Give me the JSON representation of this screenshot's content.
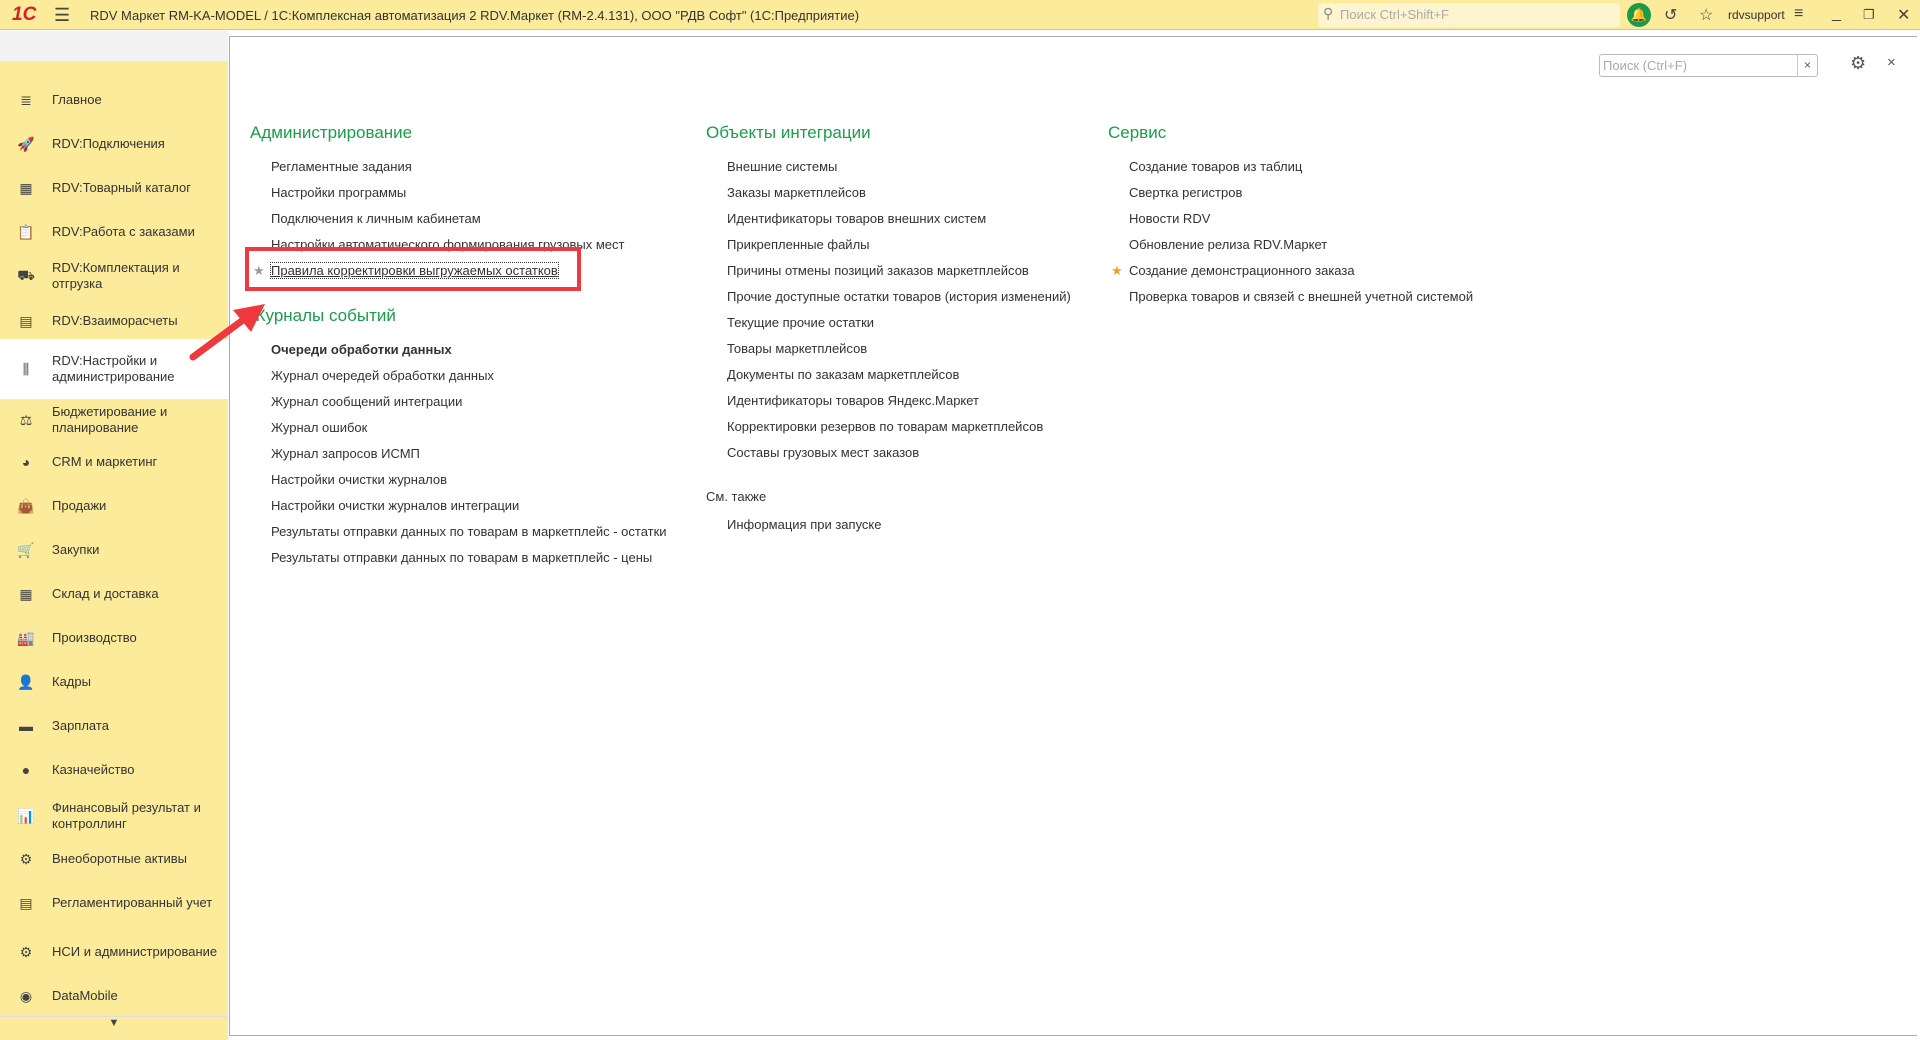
{
  "titlebar": {
    "logo": "1С",
    "title": "RDV Маркет RM-KA-MODEL / 1С:Комплексная автоматизация 2 RDV.Маркет (RM-2.4.131), ООО \"РДВ Софт\"  (1С:Предприятие)",
    "search_placeholder": "Поиск Ctrl+Shift+F",
    "user": "rdvsupport"
  },
  "sidebar": {
    "items": [
      {
        "label": "Главное",
        "icon": "≣"
      },
      {
        "label": "RDV:Подключения",
        "icon": "🚀"
      },
      {
        "label": "RDV:Товарный каталог",
        "icon": "▦"
      },
      {
        "label": "RDV:Работа с заказами",
        "icon": "📋"
      },
      {
        "label": "RDV:Комплектация и отгрузка",
        "icon": "⛟"
      },
      {
        "label": "RDV:Взаиморасчеты",
        "icon": "▤"
      },
      {
        "label": "RDV:Настройки и администрирование",
        "icon": "⫼",
        "active": true
      },
      {
        "label": "Бюджетирование и планирование",
        "icon": "⚖"
      },
      {
        "label": "CRM и маркетинг",
        "icon": "◕"
      },
      {
        "label": "Продажи",
        "icon": "👜"
      },
      {
        "label": "Закупки",
        "icon": "🛒"
      },
      {
        "label": "Склад и доставка",
        "icon": "▦"
      },
      {
        "label": "Производство",
        "icon": "🏭"
      },
      {
        "label": "Кадры",
        "icon": "👤"
      },
      {
        "label": "Зарплата",
        "icon": "▬"
      },
      {
        "label": "Казначейство",
        "icon": "●"
      },
      {
        "label": "Финансовый результат и контроллинг",
        "icon": "📊"
      },
      {
        "label": "Внеоборотные активы",
        "icon": "⚙"
      },
      {
        "label": "Регламентированный учет",
        "icon": "▤"
      },
      {
        "label": "НСИ и администрирование",
        "icon": "⚙"
      },
      {
        "label": "DataMobile",
        "icon": "◉"
      }
    ],
    "scroll_down": "▼"
  },
  "main": {
    "search_placeholder": "Поиск (Ctrl+F)",
    "clear": "×",
    "close": "×",
    "col1": {
      "heading": "Администрирование",
      "items": [
        "Регламентные задания",
        "Настройки программы",
        "Подключения к личным кабинетам",
        "Настройки автоматического формирования грузовых мест",
        "Правила корректировки выгружаемых остатков"
      ],
      "heading2": "Журналы событий",
      "items2": [
        "Очереди обработки данных",
        "Журнал очередей обработки данных",
        "Журнал сообщений интеграции",
        "Журнал ошибок",
        "Журнал запросов ИСМП",
        "Настройки очистки журналов",
        "Настройки очистки журналов интеграции",
        "Результаты отправки данных по товарам в маркетплейс - остатки",
        "Результаты отправки данных по товарам в маркетплейс - цены"
      ]
    },
    "col2": {
      "heading": "Объекты интеграции",
      "items": [
        "Внешние системы",
        "Заказы маркетплейсов",
        "Идентификаторы товаров внешних систем",
        "Прикрепленные файлы",
        "Причины отмены позиций заказов маркетплейсов",
        "Прочие доступные остатки товаров (история изменений)",
        "Текущие прочие остатки",
        "Товары маркетплейсов",
        "Документы по заказам маркетплейсов",
        "Идентификаторы товаров Яндекс.Маркет",
        "Корректировки резервов по товарам маркетплейсов",
        "Составы грузовых мест заказов"
      ],
      "see_also": "См. также",
      "items2": [
        "Информация при запуске"
      ]
    },
    "col3": {
      "heading": "Сервис",
      "items": [
        "Создание товаров из таблиц",
        "Свертка регистров",
        "Новости RDV",
        "Обновление релиза RDV.Маркет",
        "Создание демонстрационного заказа",
        "Проверка товаров и связей с внешней учетной системой"
      ]
    }
  },
  "colors": {
    "accent": "#1a9e4a",
    "titlebar": "#fbeb9b",
    "highlight": "#f0383f",
    "star_gold": "#f0a020"
  }
}
